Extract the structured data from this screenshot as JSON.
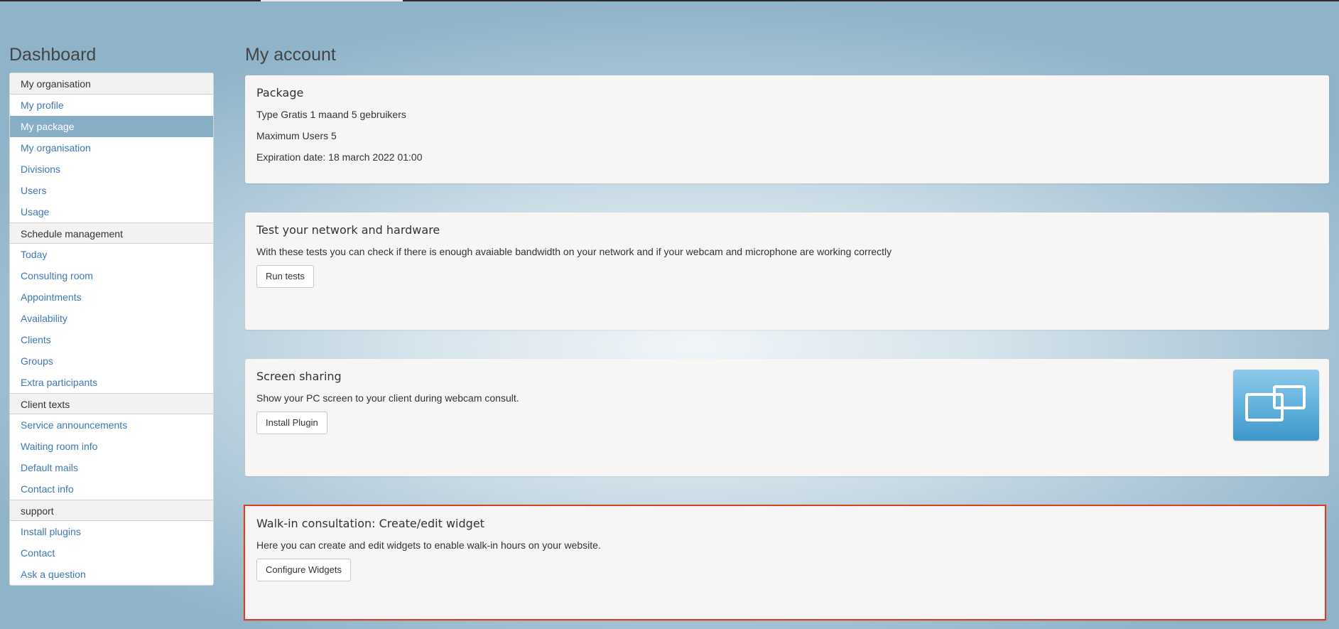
{
  "dashboard_title": "Dashboard",
  "account_title": "My account",
  "sidebar": {
    "items": [
      {
        "label": "My organisation",
        "type": "header"
      },
      {
        "label": "My profile",
        "type": "link"
      },
      {
        "label": "My package",
        "type": "active"
      },
      {
        "label": "My organisation",
        "type": "link"
      },
      {
        "label": "Divisions",
        "type": "link"
      },
      {
        "label": "Users",
        "type": "link"
      },
      {
        "label": "Usage",
        "type": "link"
      },
      {
        "label": "Schedule management",
        "type": "header"
      },
      {
        "label": "Today",
        "type": "link"
      },
      {
        "label": "Consulting room",
        "type": "link"
      },
      {
        "label": "Appointments",
        "type": "link"
      },
      {
        "label": "Availability",
        "type": "link"
      },
      {
        "label": "Clients",
        "type": "link"
      },
      {
        "label": "Groups",
        "type": "link"
      },
      {
        "label": "Extra participants",
        "type": "link"
      },
      {
        "label": "Client texts",
        "type": "header"
      },
      {
        "label": "Service announcements",
        "type": "link"
      },
      {
        "label": "Waiting room info",
        "type": "link"
      },
      {
        "label": "Default mails",
        "type": "link"
      },
      {
        "label": "Contact info",
        "type": "link"
      },
      {
        "label": "support",
        "type": "header"
      },
      {
        "label": "Install plugins",
        "type": "link"
      },
      {
        "label": "Contact",
        "type": "link"
      },
      {
        "label": "Ask a question",
        "type": "link"
      }
    ]
  },
  "package": {
    "title": "Package",
    "type_line": "Type Gratis 1 maand 5 gebruikers",
    "max_users": "Maximum Users 5",
    "expiration": "Expiration date: 18 march 2022 01:00"
  },
  "test": {
    "title": "Test your network and hardware",
    "text": "With these tests you can check if there is enough avaiable bandwidth on your network and if your webcam and microphone are working correctly",
    "button": "Run tests"
  },
  "screen": {
    "title": "Screen sharing",
    "text": "Show your PC screen to your client during webcam consult.",
    "button": "Install Plugin",
    "icon": "screen-sharing-icon"
  },
  "walkin": {
    "title": "Walk-in consultation: Create/edit widget",
    "text": "Here you can create and edit widgets to enable walk-in hours on your website.",
    "button": "Configure Widgets"
  },
  "colors": {
    "link": "#3b79b2",
    "active_bg": "#86aec4",
    "highlight_border": "#e03a20",
    "icon_blue": "#5fb0dc"
  }
}
